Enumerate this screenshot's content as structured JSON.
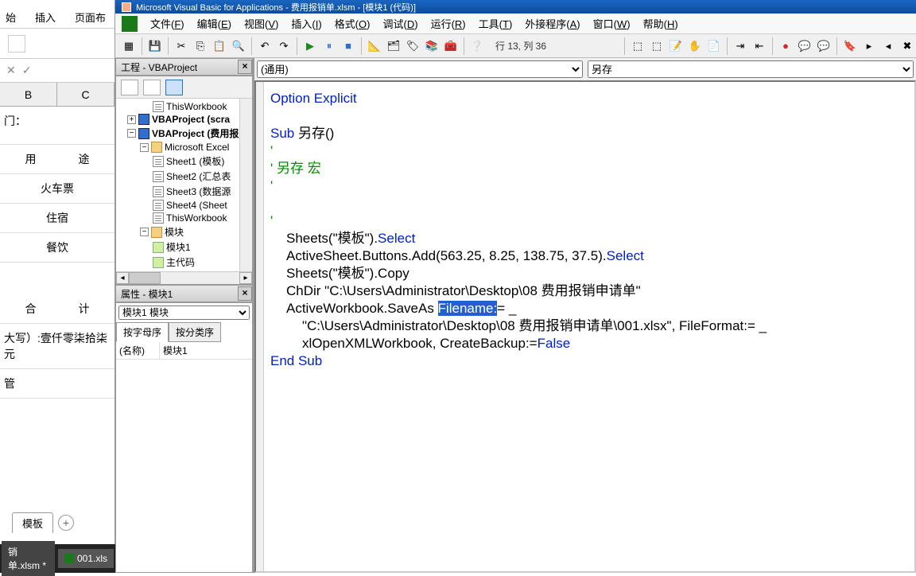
{
  "excel": {
    "tabs": [
      "始",
      "插入",
      "页面布"
    ],
    "headers": [
      "B",
      "C"
    ],
    "rows": {
      "r1": "门：",
      "r2a": "用",
      "r2b": "途",
      "r3": "火车票",
      "r4": "住宿",
      "r5": "餐饮",
      "r6a": "合",
      "r6b": "计",
      "r7": "大写）:壹仟零柒拾柒元",
      "r8": "管"
    },
    "sheet_tab": "模板",
    "taskbar1": "销单.xlsm *",
    "taskbar2": "001.xls"
  },
  "vba": {
    "title": "Microsoft Visual Basic for Applications - 费用报销单.xlsm - [模块1 (代码)]",
    "menu": [
      "文件(F)",
      "编辑(E)",
      "视图(V)",
      "插入(I)",
      "格式(O)",
      "调试(D)",
      "运行(R)",
      "工具(T)",
      "外接程序(A)",
      "窗口(W)",
      "帮助(H)"
    ],
    "status": "行 13, 列 36",
    "project_title": "工程 - VBAProject",
    "tree": {
      "n1": "ThisWorkbook",
      "n2": "VBAProject (scra",
      "n3": "VBAProject (费用报",
      "n4": "Microsoft Excel",
      "n5": "Sheet1 (模板)",
      "n6": "Sheet2 (汇总表",
      "n7": "Sheet3 (数据源",
      "n8": "Sheet4 (Sheet",
      "n9": "ThisWorkbook",
      "n10": "模块",
      "n11": "模块1",
      "n12": "主代码"
    },
    "props_title": "属性 - 模块1",
    "props_select": "模块1 模块",
    "props_tab1": "按字母序",
    "props_tab2": "按分类序",
    "props_name": "(名称)",
    "props_val": "模块1",
    "code_drop1": "(通用)",
    "code_drop2": "另存",
    "code": {
      "l1": "Option Explicit",
      "l2a": "Sub",
      "l2b": " 另存()",
      "l3": "'",
      "l4": "' 另存 宏",
      "l5": "'",
      "l6": "'",
      "l7a": "Sheets(\"模板\").",
      "l7b": "Select",
      "l8a": "ActiveSheet.Buttons.Add(563.25, 8.25, 138.75, 37.5).",
      "l8b": "Select",
      "l9": "Sheets(\"模板\").Copy",
      "l10": "ChDir \"C:\\Users\\Administrator\\Desktop\\08 费用报销申请单\"",
      "l11a": "ActiveWorkbook.SaveAs ",
      "l11sel": "Filename:",
      "l11b": "= _",
      "l12": "\"C:\\Users\\Administrator\\Desktop\\08 费用报销申请单\\001.xlsx\", FileFormat:= _",
      "l13a": "xlOpenXMLWorkbook, CreateBackup:=",
      "l13b": "False",
      "l14": "End Sub"
    }
  }
}
